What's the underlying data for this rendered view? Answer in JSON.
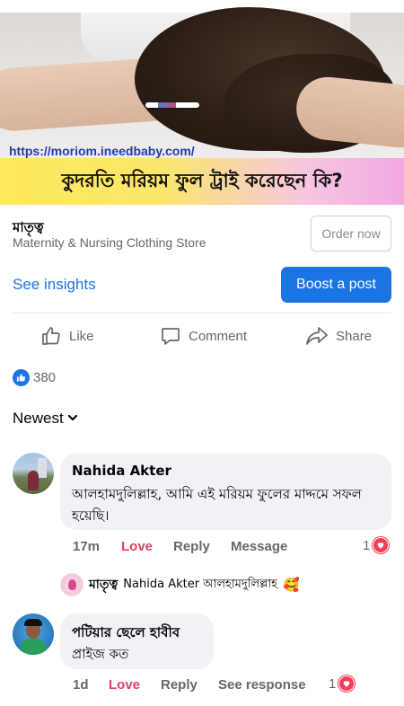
{
  "post": {
    "image_url_text": "https://moriom.ineedbaby.com/",
    "banner_text": "কুদরতি মরিয়ম ফুল ট্রাই করেছেন কি?"
  },
  "page": {
    "name": "মাতৃত্ব",
    "category": "Maternity & Nursing Clothing Store",
    "order_button": "Order now"
  },
  "insights": {
    "see_insights": "See insights",
    "boost_button": "Boost a post"
  },
  "actions": {
    "like": "Like",
    "comment": "Comment",
    "share": "Share"
  },
  "reactions": {
    "count": "380",
    "icon": "thumbs-up-icon",
    "color": "#1b74e4"
  },
  "sort": {
    "label": "Newest"
  },
  "comments": [
    {
      "author": "Nahida Akter",
      "text": "আলহামদুলিল্লাহ, আমি এই মরিয়ম  ফুলের মাদ্দমে সফল হয়েছি।",
      "time": "17m",
      "love": "Love",
      "reply": "Reply",
      "extra": "Message",
      "reaction_count": "1"
    },
    {
      "author": "পটিয়ার ছেলে হাবীব",
      "text": "প্রাইজ কত",
      "time": "1d",
      "love": "Love",
      "reply": "Reply",
      "extra": "See response",
      "reaction_count": "1"
    }
  ],
  "reply_preview": {
    "author": "মাতৃত্ব",
    "text": "Nahida Akter আলহামদুলিল্লাহ",
    "emoji": "🥰"
  },
  "colors": {
    "accent": "#1b74e4",
    "love": "#e4405f",
    "heart": "#f33e58"
  }
}
